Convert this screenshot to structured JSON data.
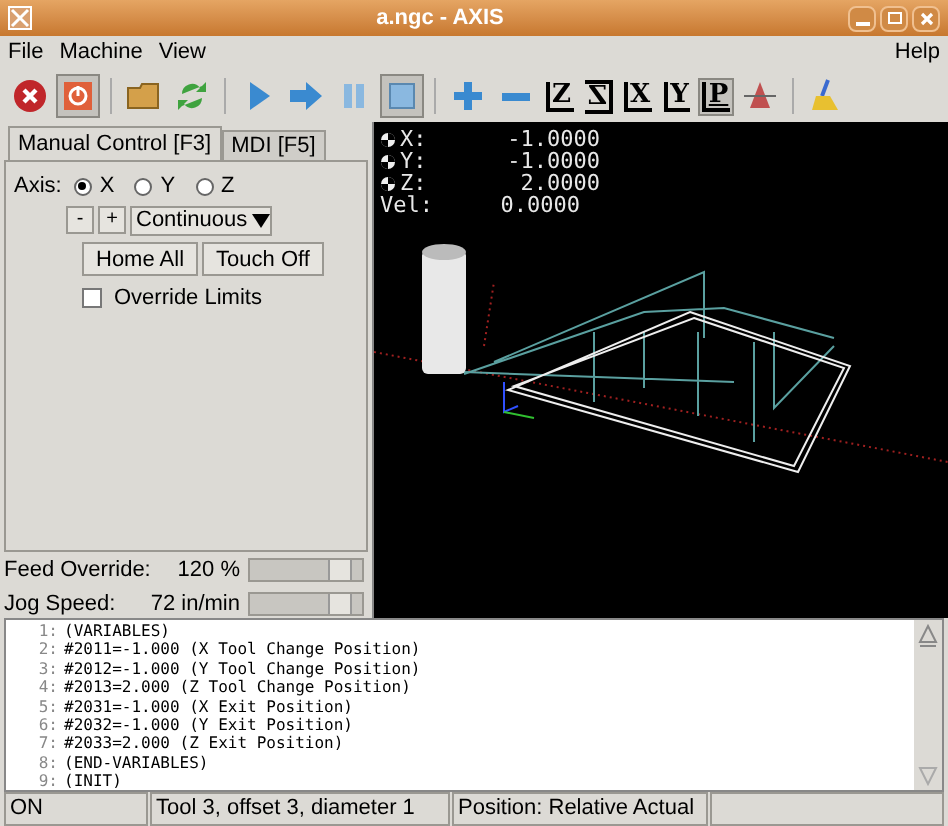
{
  "window": {
    "title": "a.ngc - AXIS"
  },
  "menu": {
    "left": [
      "File",
      "Machine",
      "View"
    ],
    "right": [
      "Help"
    ]
  },
  "toolbar": [
    {
      "kind": "estop",
      "selected": false
    },
    {
      "kind": "power",
      "selected": true
    },
    {
      "kind": "sep"
    },
    {
      "kind": "open",
      "selected": false
    },
    {
      "kind": "reload",
      "selected": false
    },
    {
      "kind": "sep"
    },
    {
      "kind": "run",
      "selected": false
    },
    {
      "kind": "step",
      "selected": false
    },
    {
      "kind": "pause",
      "selected": false
    },
    {
      "kind": "stop",
      "selected": true
    },
    {
      "kind": "sep"
    },
    {
      "kind": "zoom_in",
      "selected": false
    },
    {
      "kind": "zoom_out",
      "selected": false
    },
    {
      "kind": "view",
      "label": "Z",
      "selected": false
    },
    {
      "kind": "view_rot",
      "label": "Z",
      "selected": false
    },
    {
      "kind": "view",
      "label": "X",
      "selected": false
    },
    {
      "kind": "view",
      "label": "Y",
      "selected": false
    },
    {
      "kind": "view_p",
      "label": "P",
      "selected": true
    },
    {
      "kind": "cone",
      "selected": false
    },
    {
      "kind": "sep"
    },
    {
      "kind": "clear",
      "selected": false
    }
  ],
  "tabs": [
    {
      "label": "Manual Control [F3]",
      "selected": true
    },
    {
      "label": "MDI [F5]",
      "selected": false
    }
  ],
  "axis": {
    "label": "Axis:",
    "options": [
      {
        "label": "X",
        "selected": true
      },
      {
        "label": "Y",
        "selected": false
      },
      {
        "label": "Z",
        "selected": false
      }
    ]
  },
  "jog": {
    "minus": "-",
    "plus": "+",
    "mode": "Continuous"
  },
  "buttons": [
    "Home All",
    "Touch Off"
  ],
  "override_limits": {
    "label": "Override Limits",
    "checked": false
  },
  "sliders": [
    {
      "label": "Feed Override:",
      "reading": "120 %",
      "level": 0.85
    },
    {
      "label": "Jog Speed:",
      "reading": "72 in/min",
      "level": 0.85
    }
  ],
  "dro": [
    {
      "label": "X:",
      "value": "-1.0000",
      "homed": true
    },
    {
      "label": "Y:",
      "value": "-1.0000",
      "homed": true
    },
    {
      "label": "Z:",
      "value": "2.0000",
      "homed": true
    },
    {
      "label": "Vel:",
      "value": "0.0000",
      "homed": false
    }
  ],
  "code": [
    {
      "number": "1:",
      "text": "(VARIABLES)"
    },
    {
      "number": "2:",
      "text": "#2011=-1.000 (X Tool Change Position)"
    },
    {
      "number": "3:",
      "text": "#2012=-1.000 (Y Tool Change Position)"
    },
    {
      "number": "4:",
      "text": "#2013=2.000 (Z Tool Change Position)"
    },
    {
      "number": "5:",
      "text": "#2031=-1.000 (X Exit Position)"
    },
    {
      "number": "6:",
      "text": "#2032=-1.000 (Y Exit Position)"
    },
    {
      "number": "7:",
      "text": "#2033=2.000 (Z Exit Position)"
    },
    {
      "number": "8:",
      "text": "(END-VARIABLES)"
    },
    {
      "number": "9:",
      "text": "(INIT)"
    }
  ],
  "status_bar": [
    "ON",
    "Tool 3, offset 3, diameter 1",
    "Position: Relative Actual"
  ]
}
